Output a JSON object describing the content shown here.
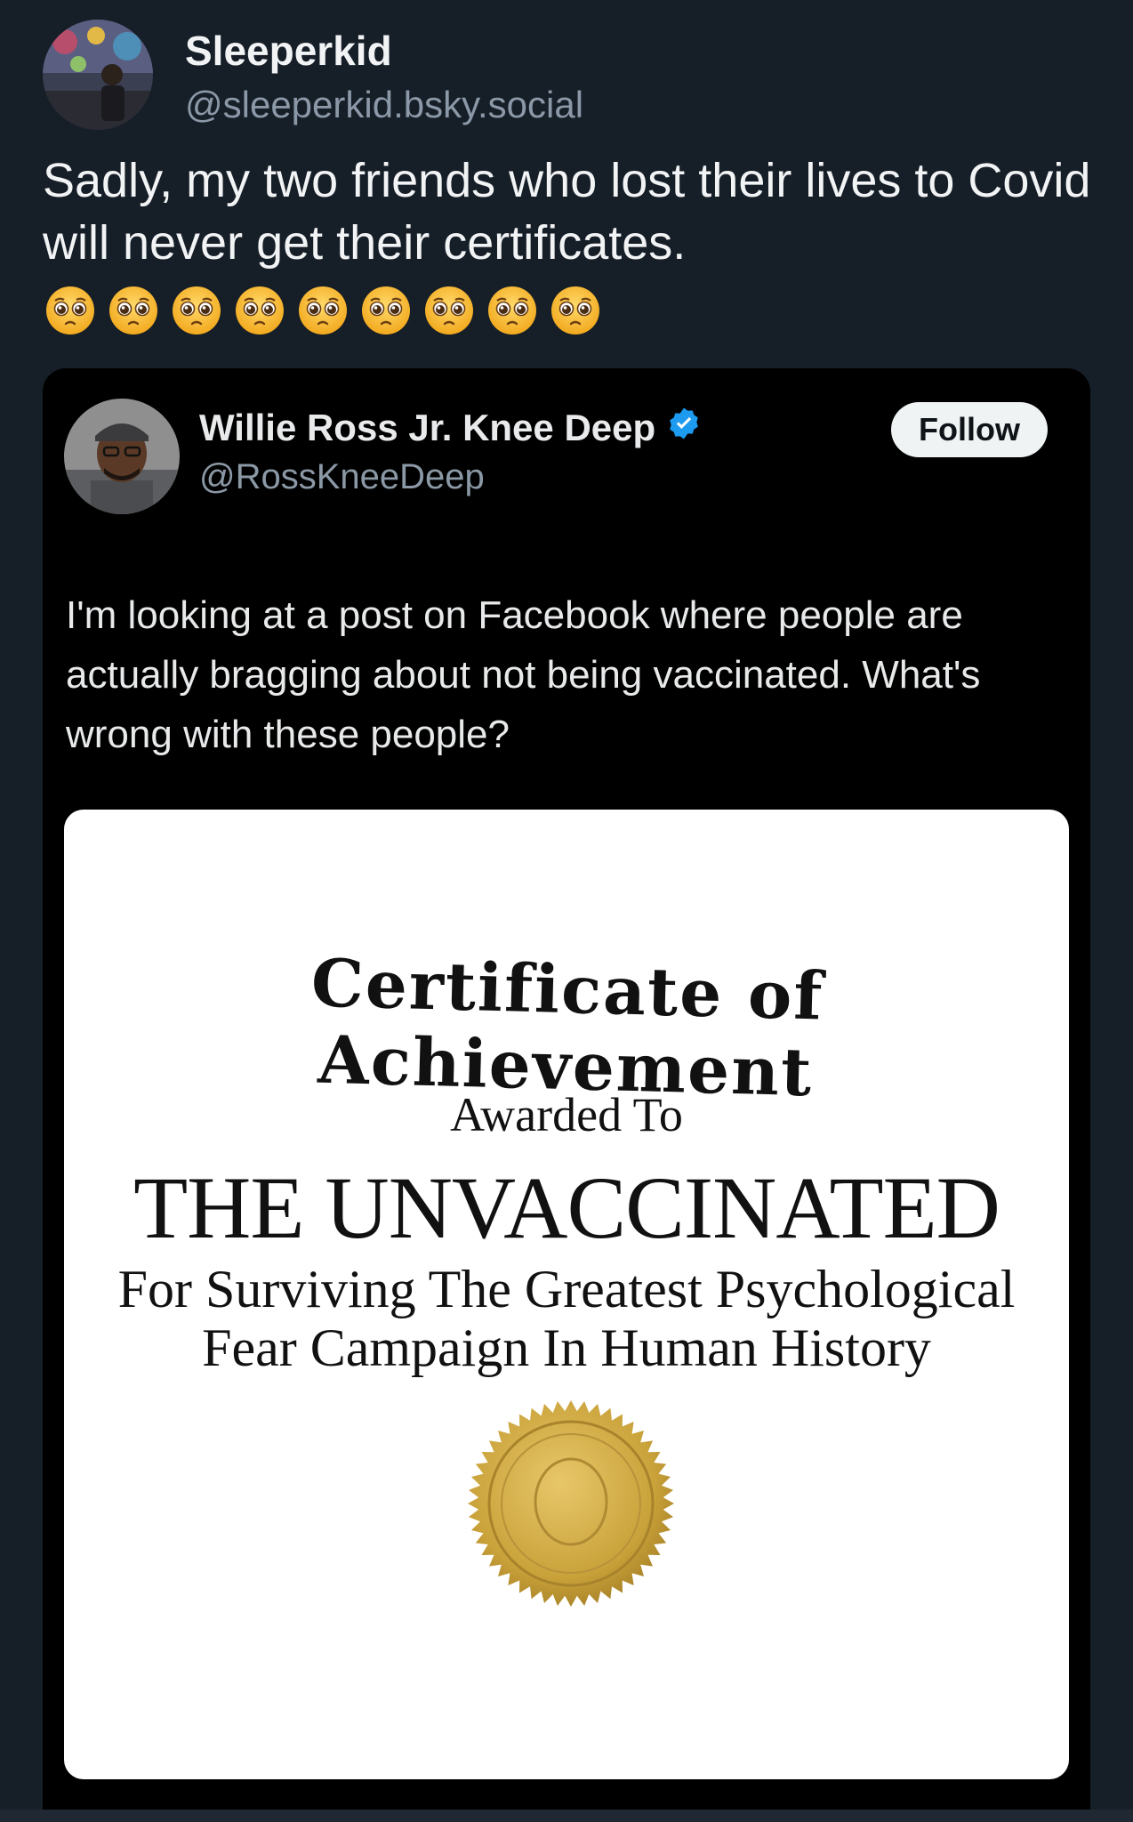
{
  "post": {
    "author_name": "Sleeperkid",
    "author_handle": "@sleeperkid.bsky.social",
    "text": "Sadly, my two friends who lost their lives to Covid will never get their certificates.",
    "emoji_name": "pleading-face-emoji",
    "emoji_count": 9
  },
  "embed": {
    "author_name": "Willie Ross Jr. Knee Deep",
    "author_handle": "@RossKneeDeep",
    "verified_icon": "verified-badge-icon",
    "follow_label": "Follow",
    "text": "I'm looking at a post on Facebook where people are actually bragging about not being vaccinated. What's wrong with these people?",
    "image": {
      "title": "Certificate of Achievement",
      "awarded": "Awarded To",
      "recipient": "THE UNVACCINATED",
      "reason_line1": "For Surviving The Greatest Psychological",
      "reason_line2": "Fear Campaign In Human History",
      "seal_icon": "gold-seal-icon"
    }
  },
  "colors": {
    "background": "#161e27",
    "embed_background": "#000000",
    "verified": "#1d9bf0",
    "seal": "#c9a23a"
  }
}
